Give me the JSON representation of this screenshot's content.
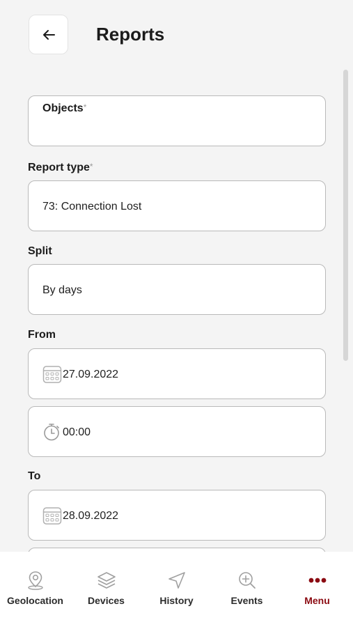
{
  "header": {
    "title": "Reports"
  },
  "form": {
    "objects": {
      "label": "Objects",
      "required_mark": "*",
      "value": ""
    },
    "report_type": {
      "label": "Report type",
      "required_mark": "*",
      "value": "73: Connection Lost"
    },
    "split": {
      "label": "Split",
      "value": "By days"
    },
    "from": {
      "label": "From",
      "date": "27.09.2022",
      "time": "00:00"
    },
    "to": {
      "label": "To",
      "date": "28.09.2022"
    }
  },
  "bottom_nav": {
    "items": [
      {
        "label": "Geolocation",
        "icon": "geolocation-pin-icon",
        "active": false
      },
      {
        "label": "Devices",
        "icon": "layers-icon",
        "active": false
      },
      {
        "label": "History",
        "icon": "navigation-arrow-icon",
        "active": false
      },
      {
        "label": "Events",
        "icon": "zoom-in-icon",
        "active": false
      },
      {
        "label": "Menu",
        "icon": "more-dots-icon",
        "active": true
      }
    ]
  },
  "colors": {
    "accent": "#8b0b12",
    "background": "#f4f4f4",
    "field_border": "#b9b9b9",
    "icon_gray": "#9a9a9a"
  }
}
